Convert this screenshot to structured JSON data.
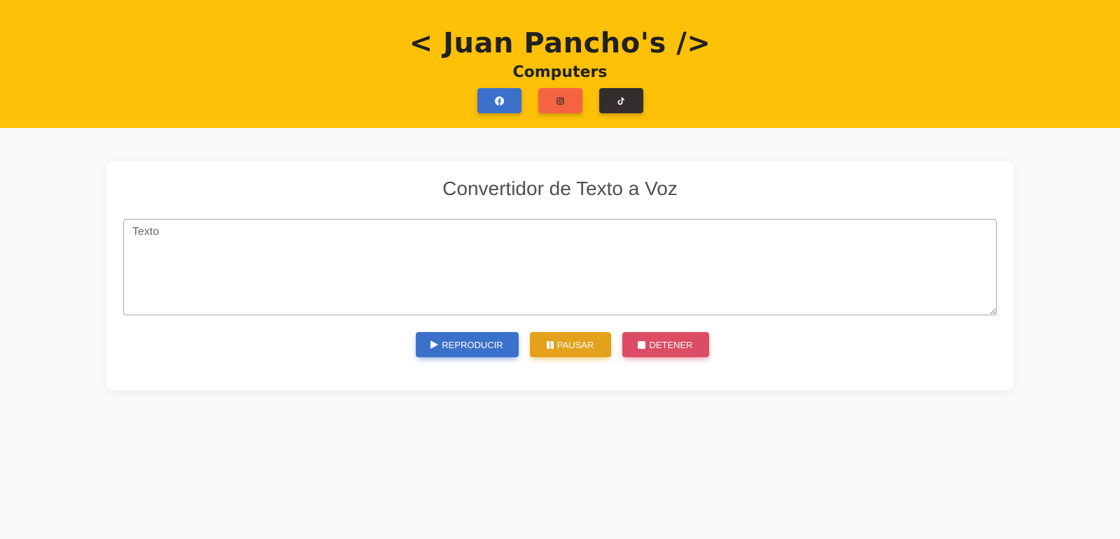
{
  "header": {
    "title": "< Juan Pancho's />",
    "subtitle": "Computers",
    "social": [
      {
        "name": "facebook",
        "icon": "facebook-icon",
        "color": "#3b71ca"
      },
      {
        "name": "instagram",
        "icon": "instagram-icon",
        "color": "#f56441"
      },
      {
        "name": "tiktok",
        "icon": "tiktok-icon",
        "color": "#332d2d"
      }
    ],
    "background": "#ffc107"
  },
  "card": {
    "title": "Convertidor de Texto a Voz",
    "textarea": {
      "placeholder": "Texto",
      "value": ""
    },
    "buttons": {
      "play": {
        "label": "REPRODUCIR",
        "icon": "play-icon",
        "color": "#3b71ca"
      },
      "pause": {
        "label": "PAUSAR",
        "icon": "pause-icon",
        "color": "#e4a11b"
      },
      "stop": {
        "label": "DETENER",
        "icon": "stop-icon",
        "color": "#dc4c64"
      }
    }
  }
}
